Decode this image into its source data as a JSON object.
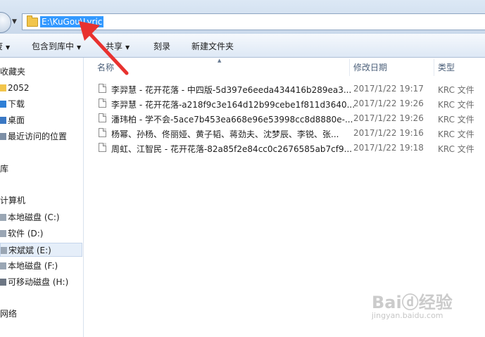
{
  "address": {
    "path": "E:\\KuGou\\Lyric"
  },
  "toolbar": {
    "partial_label": "废",
    "include_label": "包含到库中",
    "share_label": "共享",
    "burn_label": "刻录",
    "new_folder_label": "新建文件夹"
  },
  "nav": {
    "favorites": "收藏夹",
    "fav_items": [
      "2052",
      "下载",
      "桌面",
      "最近访问的位置"
    ],
    "library": "库",
    "computer": "计算机",
    "drives": [
      "本地磁盘 (C:)",
      "软件 (D:)",
      "宋斌斌 (E:)",
      "本地磁盘 (F:)",
      "可移动磁盘 (H:)"
    ],
    "network": "网络"
  },
  "columns": {
    "name": "名称",
    "date": "修改日期",
    "type": "类型"
  },
  "files": [
    {
      "name": "李羿慧 - 花开花落 - 中四版-5d397e6eeda434416b289ea3...",
      "date": "2017/1/22 19:17",
      "type": "KRC 文件"
    },
    {
      "name": "李羿慧 - 花开花落-a218f9c3e164d12b99cebe1f811d3640...",
      "date": "2017/1/22 19:26",
      "type": "KRC 文件"
    },
    {
      "name": "潘玮柏 - 学不会-5ace7b453ea668e96e53998cc8d8880e-...",
      "date": "2017/1/22 19:26",
      "type": "KRC 文件"
    },
    {
      "name": "杨幂、孙杨、佟丽娅、黄子韬、蒋劲夫、沈梦辰、李锐、张...",
      "date": "2017/1/22 19:16",
      "type": "KRC 文件"
    },
    {
      "name": "周虹、江智民 - 花开花落-82a85f2e84cc0c2676585ab7cf9...",
      "date": "2017/1/22 19:18",
      "type": "KRC 文件"
    }
  ],
  "watermark": {
    "brand": "Baiⓓ经验",
    "site": "jingyan.baidu.com"
  },
  "colors": {
    "selection": "#3399ff",
    "annotation": "#e8322f"
  }
}
